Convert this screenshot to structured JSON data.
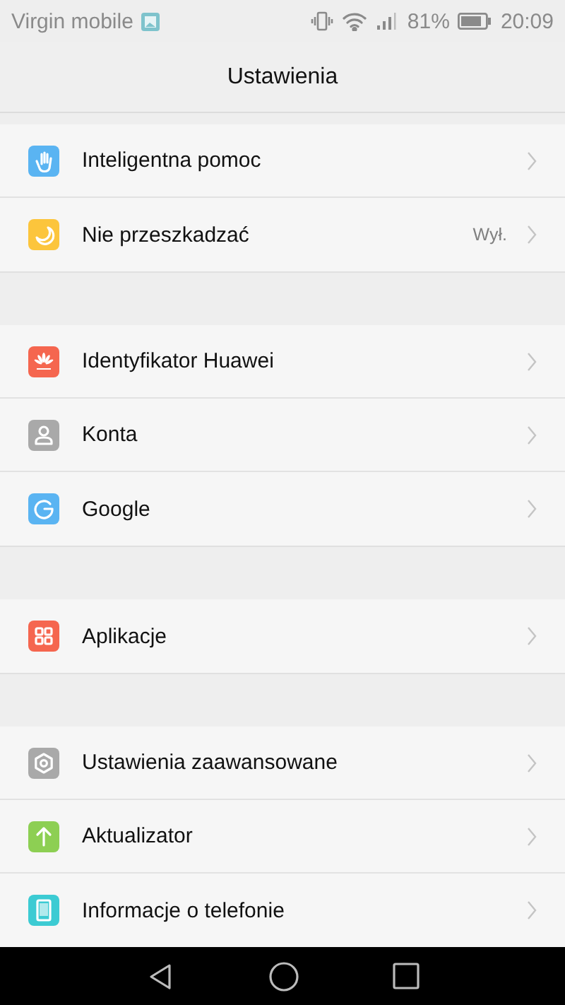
{
  "status_bar": {
    "carrier": "Virgin mobile",
    "battery": "81%",
    "time": "20:09"
  },
  "title": "Ustawienia",
  "groups": [
    {
      "items": [
        {
          "label": "Inteligentna pomoc",
          "kind": "hand",
          "color": "#5ab4f2"
        },
        {
          "label": "Nie przeszkadzać",
          "kind": "moon",
          "color": "#fcc53c",
          "value": "Wył."
        }
      ]
    },
    {
      "items": [
        {
          "label": "Identyfikator Huawei",
          "kind": "petals",
          "color": "#f5664f"
        },
        {
          "label": "Konta",
          "kind": "person",
          "color": "#a9a9a9"
        },
        {
          "label": "Google",
          "kind": "g",
          "color": "#5ab4f2"
        }
      ]
    },
    {
      "items": [
        {
          "label": "Aplikacje",
          "kind": "grid",
          "color": "#f5664f"
        }
      ]
    },
    {
      "items": [
        {
          "label": "Ustawienia zaawansowane",
          "kind": "gear",
          "color": "#a9a9a9"
        },
        {
          "label": "Aktualizator",
          "kind": "arrow",
          "color": "#8dcf53"
        },
        {
          "label": "Informacje o telefonie",
          "kind": "phone",
          "color": "#3ccbd3"
        }
      ]
    }
  ]
}
